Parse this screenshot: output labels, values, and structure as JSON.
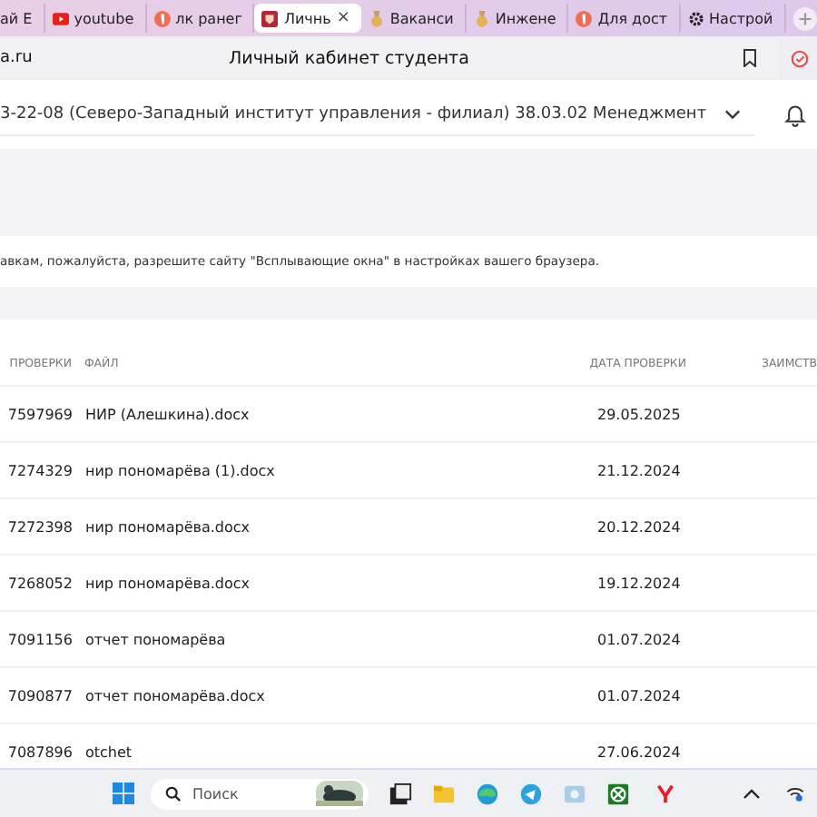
{
  "browser_tabs": [
    {
      "title": "ай Е",
      "kind": "none",
      "selected": false
    },
    {
      "title": "youtube",
      "kind": "video",
      "selected": false
    },
    {
      "title": "лк ранег",
      "kind": "ya",
      "selected": false
    },
    {
      "title": "Личнь",
      "kind": "site",
      "selected": true
    },
    {
      "title": "Ваканси",
      "kind": "medal",
      "selected": false
    },
    {
      "title": "Инжене",
      "kind": "medal",
      "selected": false
    },
    {
      "title": "Для дост",
      "kind": "ya",
      "selected": false
    },
    {
      "title": "Настрой",
      "kind": "gear",
      "selected": false
    }
  ],
  "tab_close": "×",
  "address_bar": {
    "url": "a.ru",
    "page_title": "Личный кабинет студента"
  },
  "program_select": {
    "value": "3-22-08 (Северо-Западный институт управления - филиал) 38.03.02 Менеджмент"
  },
  "notice": "авкам, пожалуйста, разрешите сайту \"Всплывающие окна\" в настройках вашего браузера.",
  "table": {
    "columns": [
      "ПРОВЕРКИ",
      "ФАЙЛ",
      "ДАТА ПРОВЕРКИ",
      "ЗАИМСТВ"
    ],
    "rows": [
      [
        "7597969",
        "НИР (Алешкина).docx",
        "29.05.2025"
      ],
      [
        "7274329",
        "нир пономарёва (1).docx",
        "21.12.2024"
      ],
      [
        "7272398",
        "нир пономарёва.docx",
        "20.12.2024"
      ],
      [
        "7268052",
        "нир пономарёва.docx",
        "19.12.2024"
      ],
      [
        "7091156",
        "отчет пономарёва",
        "01.07.2024"
      ],
      [
        "7090877",
        "отчет пономарёва.docx",
        "01.07.2024"
      ],
      [
        "7087896",
        "otchet",
        "27.06.2024"
      ]
    ]
  },
  "taskbar": {
    "search_placeholder": "Поиск"
  }
}
